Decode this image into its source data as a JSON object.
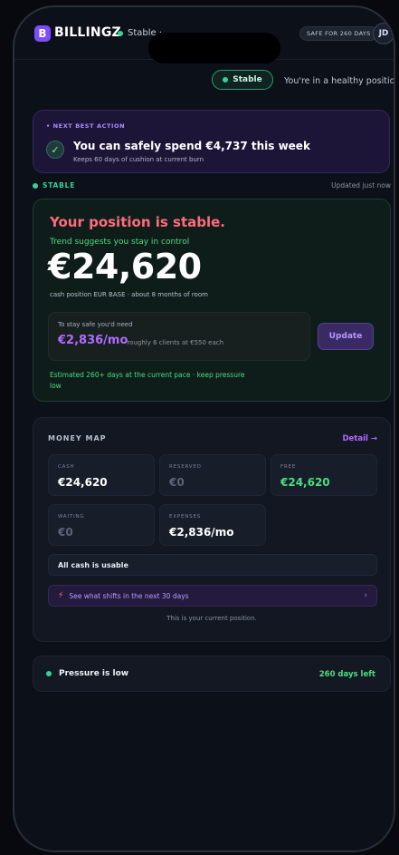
{
  "header": {
    "logo_letter": "B",
    "brand": "BILLINGZ",
    "status": "Stable · ",
    "safe_badge": "SAFE FOR 260 DAYS",
    "avatar_initials": "JD"
  },
  "status_bar": {
    "pill_label": "Stable",
    "message": "You're in a healthy position"
  },
  "next_best_action": {
    "label": "• NEXT BEST ACTION",
    "title": "You can safely spend €4,737 this week",
    "subtitle": "Keeps 60 days of cushion at current burn"
  },
  "section": {
    "label": "STABLE",
    "updated": "Updated just now"
  },
  "position": {
    "title": "Your position is stable.",
    "trend": "Trend suggests you stay in control",
    "amount": "€24,620",
    "caption": "cash position  EUR BASE · about 8 months of room",
    "safe_need": "To stay safe you'd need",
    "safe_amount": "€2,836/mo",
    "safe_roughly": "· roughly 6 clients at €550 each",
    "update_button": "Update",
    "estimate": "Estimated 260+ days at the current pace · keep pressure low"
  },
  "money_map": {
    "title": "MONEY MAP",
    "detail_link": "Detail →",
    "tiles": [
      {
        "label": "CASH",
        "value": "€24,620"
      },
      {
        "label": "RESERVED",
        "value": "€0"
      },
      {
        "label": "FREE",
        "value": "€24,620"
      },
      {
        "label": "WAITING",
        "value": "€0"
      },
      {
        "label": "EXPENSES",
        "value": "€2,836/mo"
      }
    ],
    "usable": "All cash is usable",
    "shifts_link": "See what shifts in the next 30 days",
    "chevron": "›",
    "current_position": "This is your current position."
  },
  "pressure": {
    "label": "Pressure is low",
    "days_left": "260 days left"
  },
  "colors": {
    "accent_purple": "#b26bff",
    "success_green": "#4ade80",
    "alert_red": "#ff6b7d"
  }
}
